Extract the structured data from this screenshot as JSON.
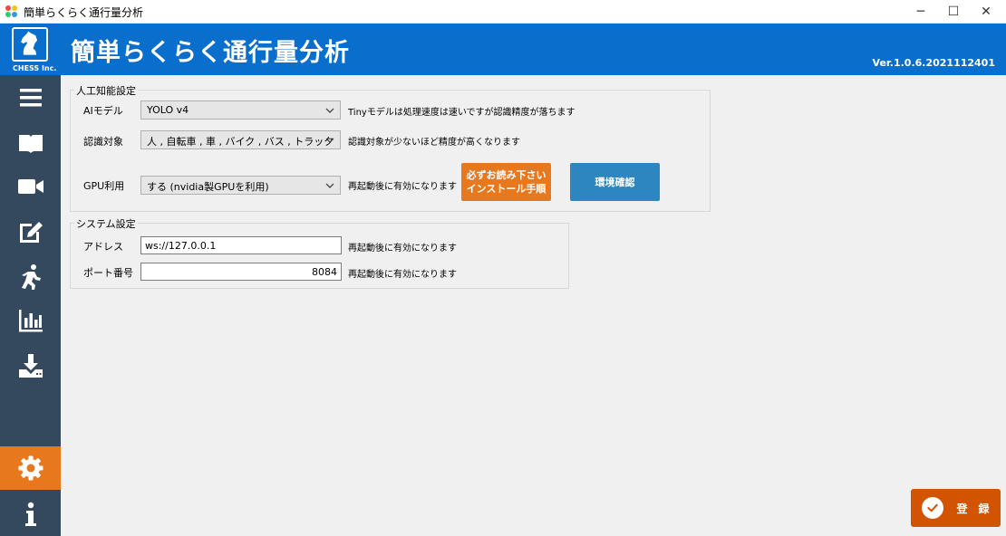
{
  "window": {
    "title": "簡単らくらく通行量分析",
    "minimize_glyph": "─",
    "maximize_glyph": "☐",
    "close_glyph": "✕"
  },
  "header": {
    "logo_text": "CHESS Inc.",
    "title": "簡単らくらく通行量分析",
    "version": "Ver.1.0.6.2021112401",
    "bg_color": "#0a6ecc"
  },
  "sidebar": {
    "bg_color": "#34495e",
    "active_color": "#e8781e",
    "items": [
      {
        "icon": "menu-icon"
      },
      {
        "icon": "book-icon"
      },
      {
        "icon": "video-camera-icon"
      },
      {
        "icon": "edit-icon"
      },
      {
        "icon": "running-person-icon"
      },
      {
        "icon": "bar-chart-icon"
      },
      {
        "icon": "download-icon"
      },
      {
        "icon": "gear-icon",
        "active": true
      },
      {
        "icon": "info-icon"
      }
    ]
  },
  "ai_settings": {
    "title": "人工知能設定",
    "model_label": "AIモデル",
    "model_value": "YOLO v4",
    "model_note": "Tinyモデルは処理速度は速いですが認識精度が落ちます",
    "target_label": "認識対象",
    "target_value": "人 , 自転車 , 車 , バイク , バス , トラック",
    "target_note": "認識対象が少ないほど精度が高くなります",
    "gpu_label": "GPU利用",
    "gpu_value": "する (nvidia製GPUを利用)",
    "gpu_note": "再起動後に有効になります",
    "install_button_line1": "必ずお読み下さい",
    "install_button_line2": "インストール手順",
    "env_check_button": "環境確認"
  },
  "system_settings": {
    "title": "システム設定",
    "address_label": "アドレス",
    "address_value": "ws://127.0.0.1",
    "address_note": "再起動後に有効になります",
    "port_label": "ポート番号",
    "port_value": "8084",
    "port_note": "再起動後に有効になります"
  },
  "footer": {
    "register_button": "登　録"
  }
}
